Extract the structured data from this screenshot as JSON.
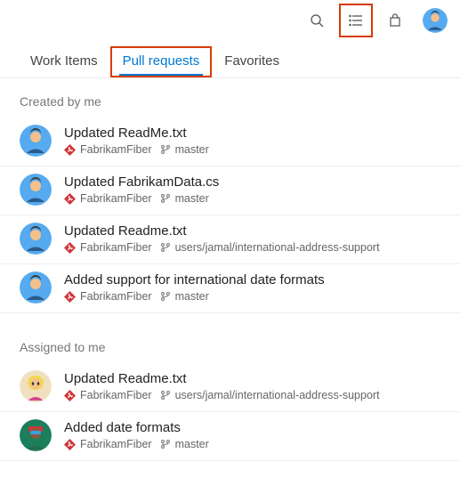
{
  "header": {
    "icons": [
      "search",
      "list",
      "shopping-bag"
    ]
  },
  "tabs": [
    {
      "label": "Work Items",
      "active": false,
      "highlight": false
    },
    {
      "label": "Pull requests",
      "active": true,
      "highlight": true
    },
    {
      "label": "Favorites",
      "active": false,
      "highlight": false
    }
  ],
  "sections": {
    "created": {
      "title": "Created by me",
      "items": [
        {
          "title": "Updated ReadMe.txt",
          "repo": "FabrikamFiber",
          "branch": "master",
          "avatar": "jamal"
        },
        {
          "title": "Updated FabrikamData.cs",
          "repo": "FabrikamFiber",
          "branch": "master",
          "avatar": "jamal"
        },
        {
          "title": "Updated Readme.txt",
          "repo": "FabrikamFiber",
          "branch": "users/jamal/international-address-support",
          "avatar": "jamal"
        },
        {
          "title": "Added support for international date formats",
          "repo": "FabrikamFiber",
          "branch": "master",
          "avatar": "jamal"
        }
      ]
    },
    "assigned": {
      "title": "Assigned to me",
      "items": [
        {
          "title": "Updated Readme.txt",
          "repo": "FabrikamFiber",
          "branch": "users/jamal/international-address-support",
          "avatar": "blonde"
        },
        {
          "title": "Added date formats",
          "repo": "FabrikamFiber",
          "branch": "master",
          "avatar": "green"
        }
      ]
    }
  }
}
